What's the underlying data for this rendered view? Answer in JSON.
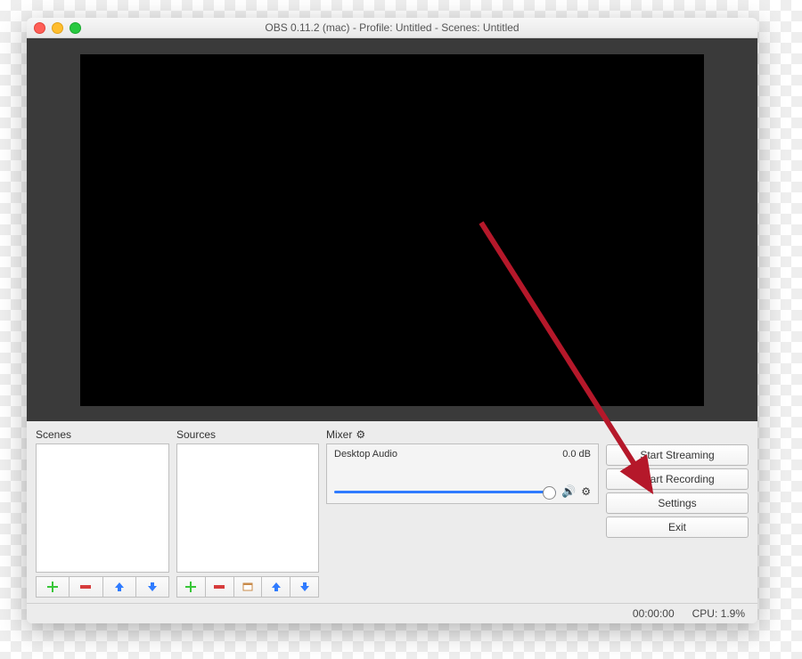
{
  "titlebar": {
    "title": "OBS 0.11.2 (mac) - Profile: Untitled - Scenes: Untitled"
  },
  "panels": {
    "scenes_label": "Scenes",
    "sources_label": "Sources",
    "mixer_label": "Mixer"
  },
  "mixer": {
    "channel_name": "Desktop Audio",
    "channel_level": "0.0 dB"
  },
  "controls": {
    "start_streaming": "Start Streaming",
    "start_recording": "Start Recording",
    "settings": "Settings",
    "exit": "Exit"
  },
  "status": {
    "time": "00:00:00",
    "cpu": "CPU: 1.9%"
  },
  "icons": {
    "plus_color": "#38c638",
    "minus_color": "#d63c3c",
    "arrow_color": "#2f7bff",
    "gear": "⚙",
    "speaker": "🔊"
  }
}
